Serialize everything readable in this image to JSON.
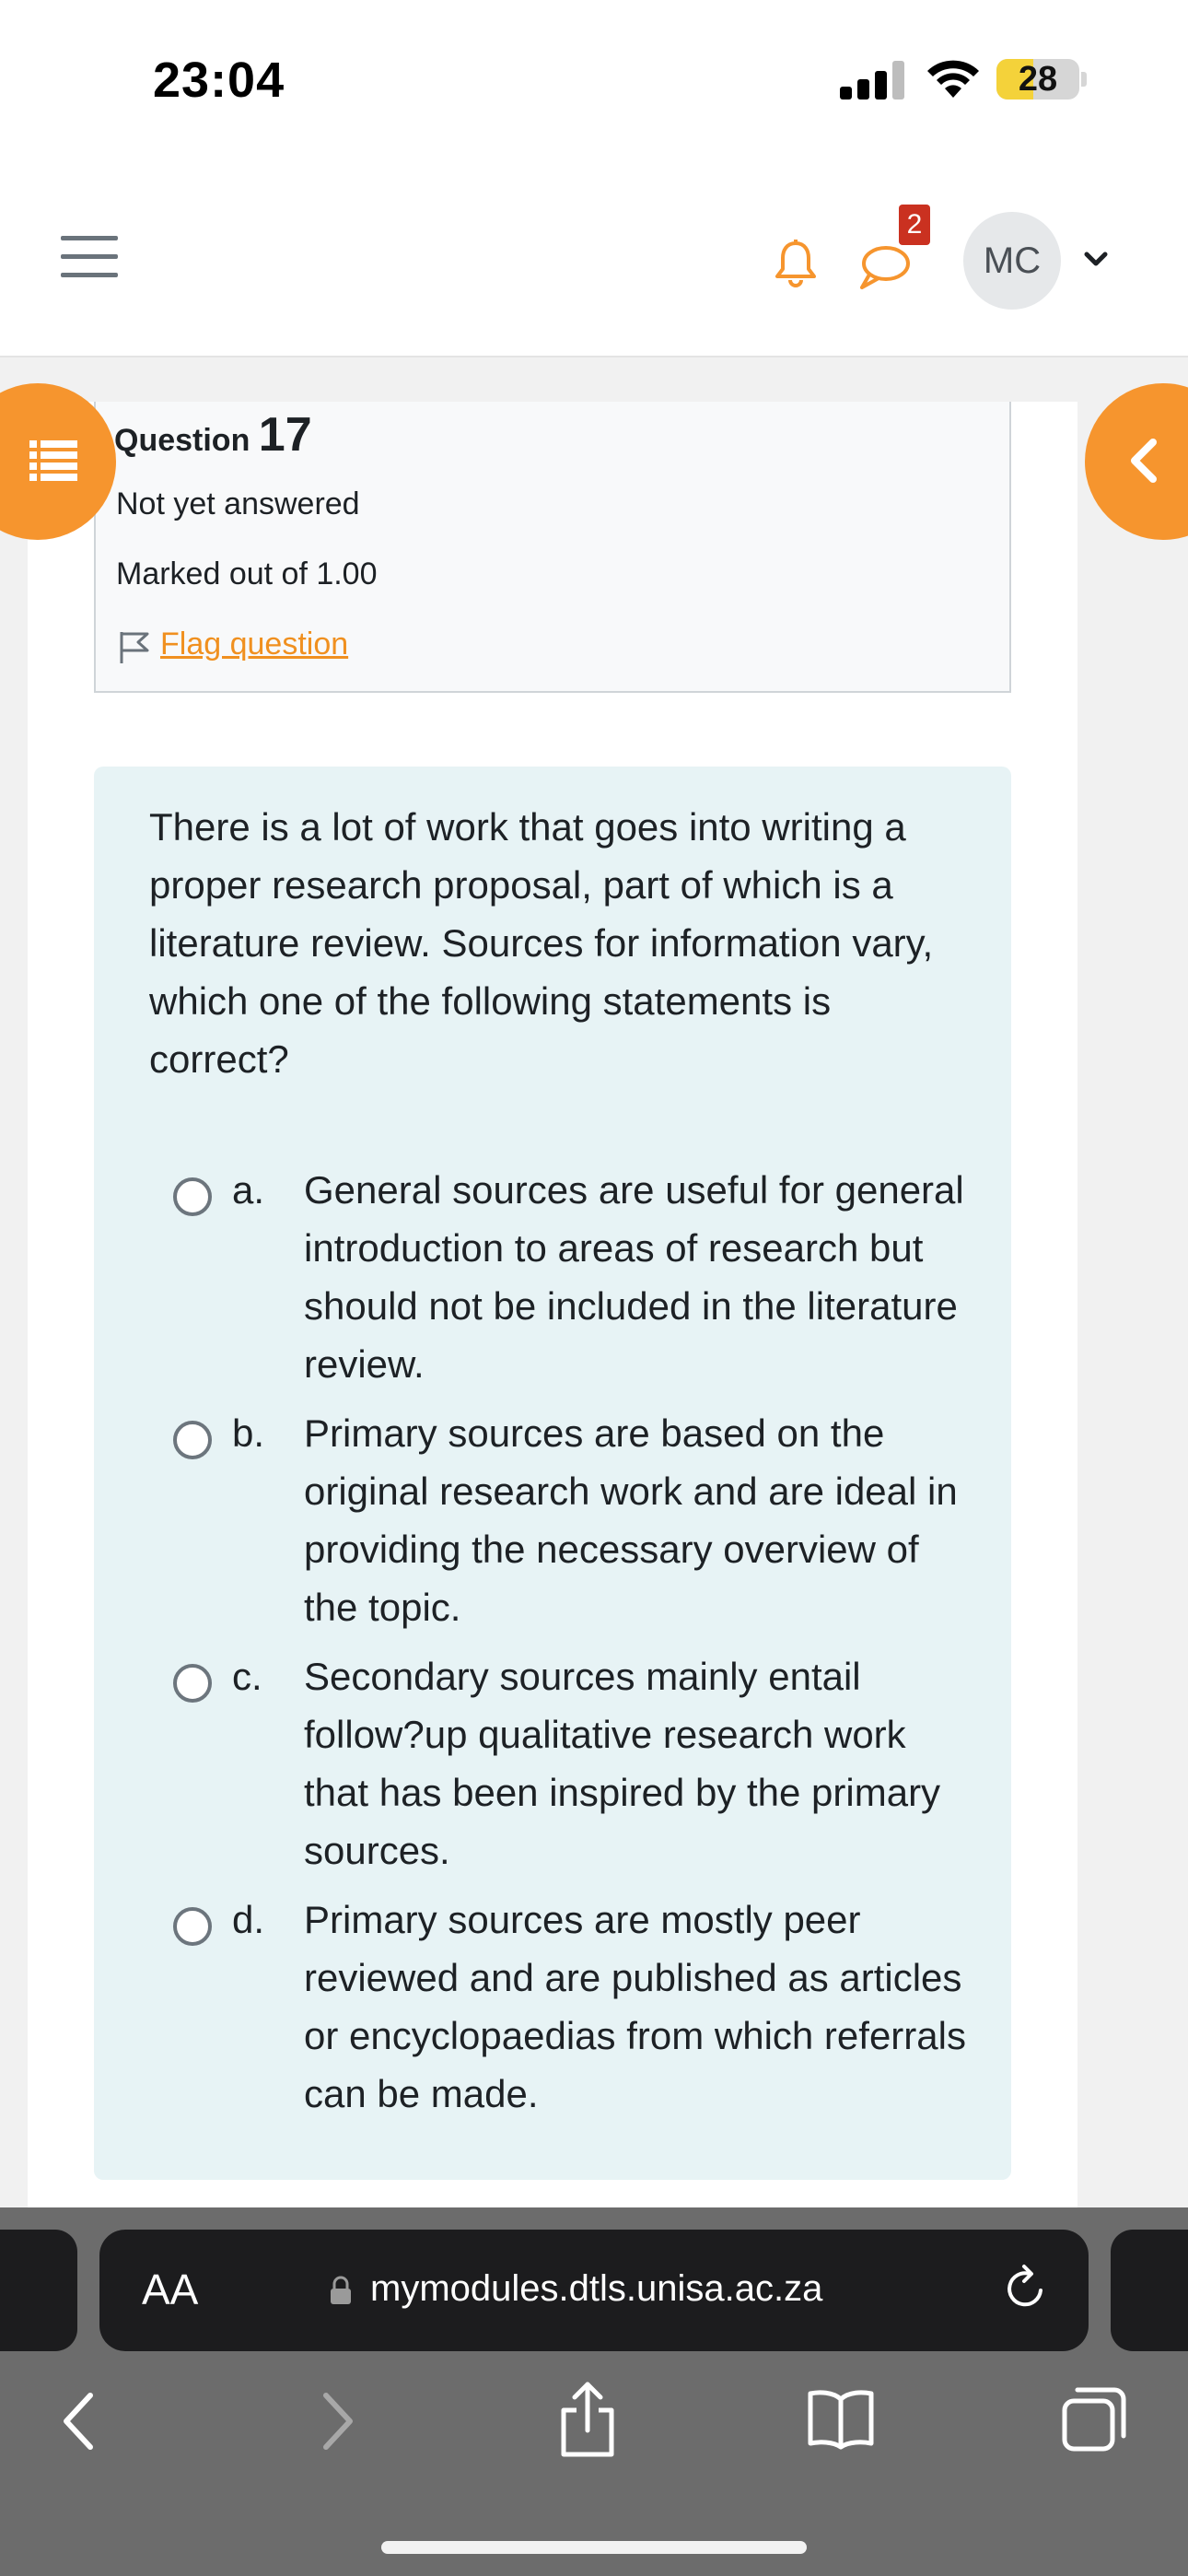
{
  "status_bar": {
    "time": "23:04",
    "battery_level": "28",
    "icons": [
      "signal-icon",
      "wifi-icon",
      "battery-icon"
    ]
  },
  "header": {
    "icons": [
      "hamburger-menu-icon",
      "bell-icon",
      "chat-icon"
    ],
    "messages_badge": "2",
    "user_initials": "MC"
  },
  "colors": {
    "accent": "#f6952e",
    "link": "#f0901f",
    "badge": "#ca3120",
    "question_bg": "#e7f3f5"
  },
  "question": {
    "label": "Question",
    "number": "17",
    "state": "Not yet answered",
    "grade": "Marked out of 1.00",
    "flag_label": "Flag question",
    "text": "There is a lot of work that goes into writing a proper research proposal, part of which is a literature review. Sources for information vary, which one of the following statements is correct?",
    "options": [
      {
        "letter": "a.",
        "text": "General sources are useful for general introduction to areas of research but should not be included in the literature review."
      },
      {
        "letter": "b.",
        "text": "Primary sources are based on the original research work and are ideal in providing the necessary overview of the topic."
      },
      {
        "letter": "c.",
        "text": "Secondary sources mainly entail follow?up qualitative research work that has been inspired by the primary sources."
      },
      {
        "letter": "d.",
        "text": "Primary sources are mostly peer reviewed and are published as articles or encyclopaedias from which referrals can be made."
      }
    ]
  },
  "browser": {
    "text_size_label": "AA",
    "url": "mymodules.dtls.unisa.ac.za",
    "toolbar_icons": [
      "back-icon",
      "forward-icon",
      "share-icon",
      "bookmarks-icon",
      "tabs-icon"
    ]
  }
}
